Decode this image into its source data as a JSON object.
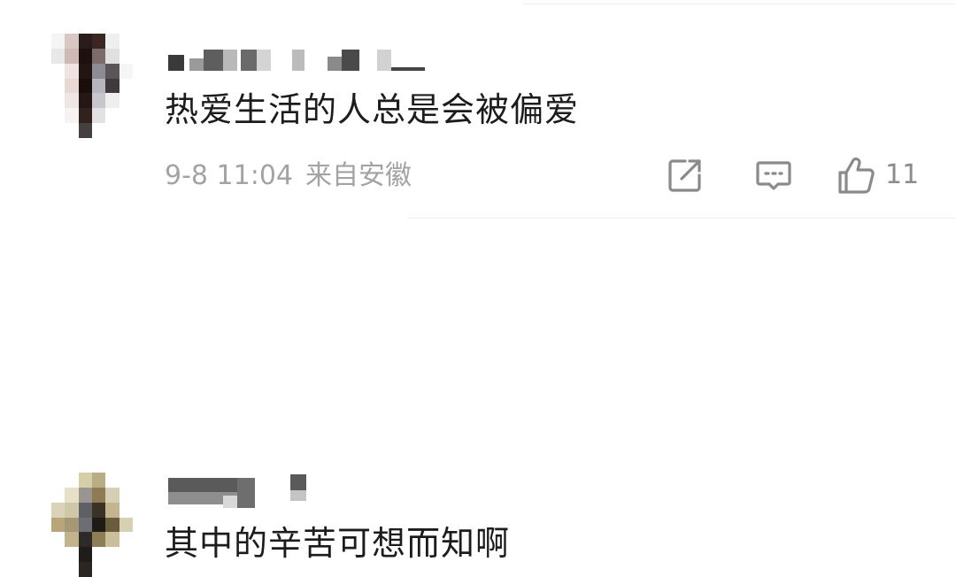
{
  "comments": [
    {
      "text": "热爱生活的人总是会被偏爱",
      "date": "9-8 11:04",
      "location": "来自安徽",
      "likes": "11",
      "icons": {
        "share": "share-icon",
        "comment": "comment-icon",
        "like": "thumbs-up-icon"
      }
    },
    {
      "text": "其中的辛苦可想而知啊"
    }
  ]
}
